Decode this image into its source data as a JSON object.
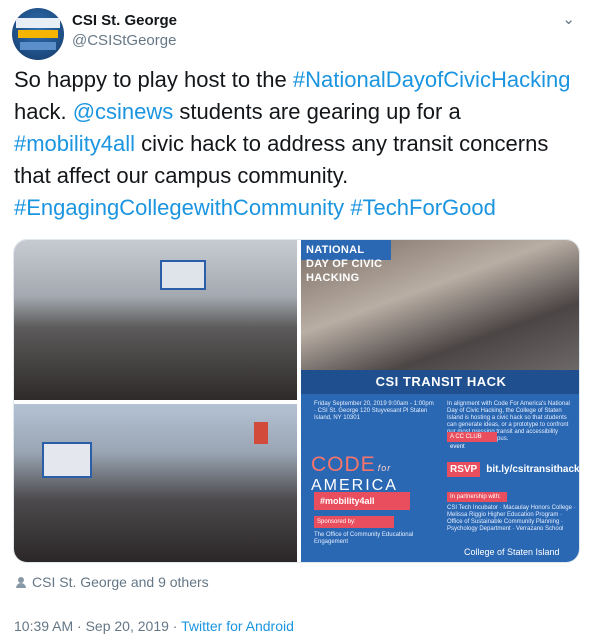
{
  "header": {
    "name": "CSI St. George",
    "handle": "@CSIStGeorge",
    "more_icon": "chevron-down-icon"
  },
  "tweet": {
    "t1": "So happy to play host to the ",
    "h1": "#NationalDayofCivicHacking",
    "t2": " hack. ",
    "m1": "@csinews",
    "t3": " students are gearing up for a ",
    "h2": "#mobility4all",
    "t4": " civic hack to address any transit concerns that affect our campus community. ",
    "h3": "#EngagingCollegewithCommunity",
    "t5": " ",
    "h4": "#TechForGood"
  },
  "colors": {
    "link": "#1b95e0",
    "muted": "#657786",
    "poster_blue": "#2a68b4",
    "poster_red": "#e94e5e"
  },
  "poster": {
    "national_day": "NATIONAL DAY OF CIVIC HACKING",
    "transit_hack": "CSI TRANSIT HACK",
    "event_details": "Friday September 20, 2019 9:00am - 1:00pm · CSI St. George 120 Stuyvesant Pl Staten Island, NY 10301",
    "code": "CODE",
    "for": "for",
    "america": "AMERICA",
    "mobility": "#mobility4all",
    "sponsored_label": "Sponsored by:",
    "sponsor_text": "The Office of Community Educational Engagement",
    "alignment_text": "In alignment with Code For America's National Day of Civic Hacking, the College of Staten Island is hosting a civic hack so that students can generate ideas, or a prototype to confront our most pressing transit and accessibility challenges on campus.",
    "cc_badge": "A CC CLUB event",
    "rsvp_label": "RSVP",
    "rsvp_link": "bit.ly/csitransithack",
    "partnership_label": "In partnership with:",
    "partners": "CSI Tech Incubator · Macaulay Honors College · Melissa Riggio Higher Education Program · Office of Sustainable Community Planning · Psychology Department · Verrazano School",
    "college": "College of Staten Island"
  },
  "footer": {
    "likers": "CSI St. George and 9 others",
    "time": "10:39 AM · Sep 20, 2019 · ",
    "source": "Twitter for Android"
  }
}
